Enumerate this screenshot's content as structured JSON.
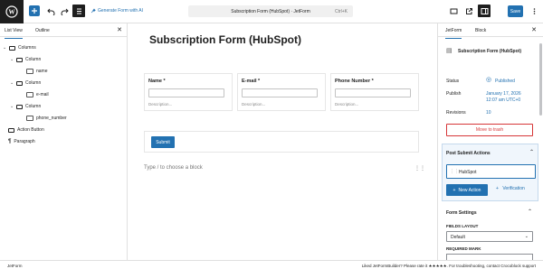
{
  "topbar": {
    "generate_ai": "Generate Form with AI",
    "doc_title": "Subscription Form (HubSpot) · JetForm",
    "shortcut": "Ctrl+K",
    "save_label": "Save"
  },
  "left_panel": {
    "tabs": [
      "List View",
      "Outline"
    ],
    "tree": [
      {
        "label": "Columns"
      },
      {
        "label": "Column"
      },
      {
        "label": "name"
      },
      {
        "label": "Column"
      },
      {
        "label": "e-mail"
      },
      {
        "label": "Column"
      },
      {
        "label": "phone_number"
      },
      {
        "label": "Action Button"
      },
      {
        "label": "Paragraph"
      }
    ]
  },
  "canvas": {
    "title": "Subscription Form (HubSpot)",
    "fields": [
      {
        "label": "Name *",
        "description": "Description..."
      },
      {
        "label": "E-mail *",
        "description": "Description..."
      },
      {
        "label": "Phone Number *",
        "description": "Description..."
      }
    ],
    "submit_label": "Submit",
    "placeholder": "Type / to choose a block"
  },
  "right_panel": {
    "tabs": [
      "JetForm",
      "Block"
    ],
    "form_name": "Subscription Form (HubSpot)",
    "status_label": "Status",
    "status_value": "Published",
    "publish_label": "Publish",
    "publish_value_1": "January 17, 2026",
    "publish_value_2": "12:07 am UTC+0",
    "revisions_label": "Revisions",
    "revisions_value": "10",
    "trash_label": "Move to trash",
    "psa_title": "Post Submit Actions",
    "psa_item": "HubSpot",
    "new_action": "New Action",
    "verification": "Verification",
    "form_settings": "Form Settings",
    "fields_layout_label": "FIELDS LAYOUT",
    "fields_layout_value": "Default",
    "required_mark_label": "REQUIRED MARK"
  },
  "footer": {
    "left": "JetForm",
    "right": "Liked JetFormBuilder? Please rate it ★★★★★. For troubleshooting, contact Crocoblock support"
  },
  "colors": {
    "accent": "#2271b1",
    "danger": "#d63638",
    "success": "#2271b1"
  }
}
